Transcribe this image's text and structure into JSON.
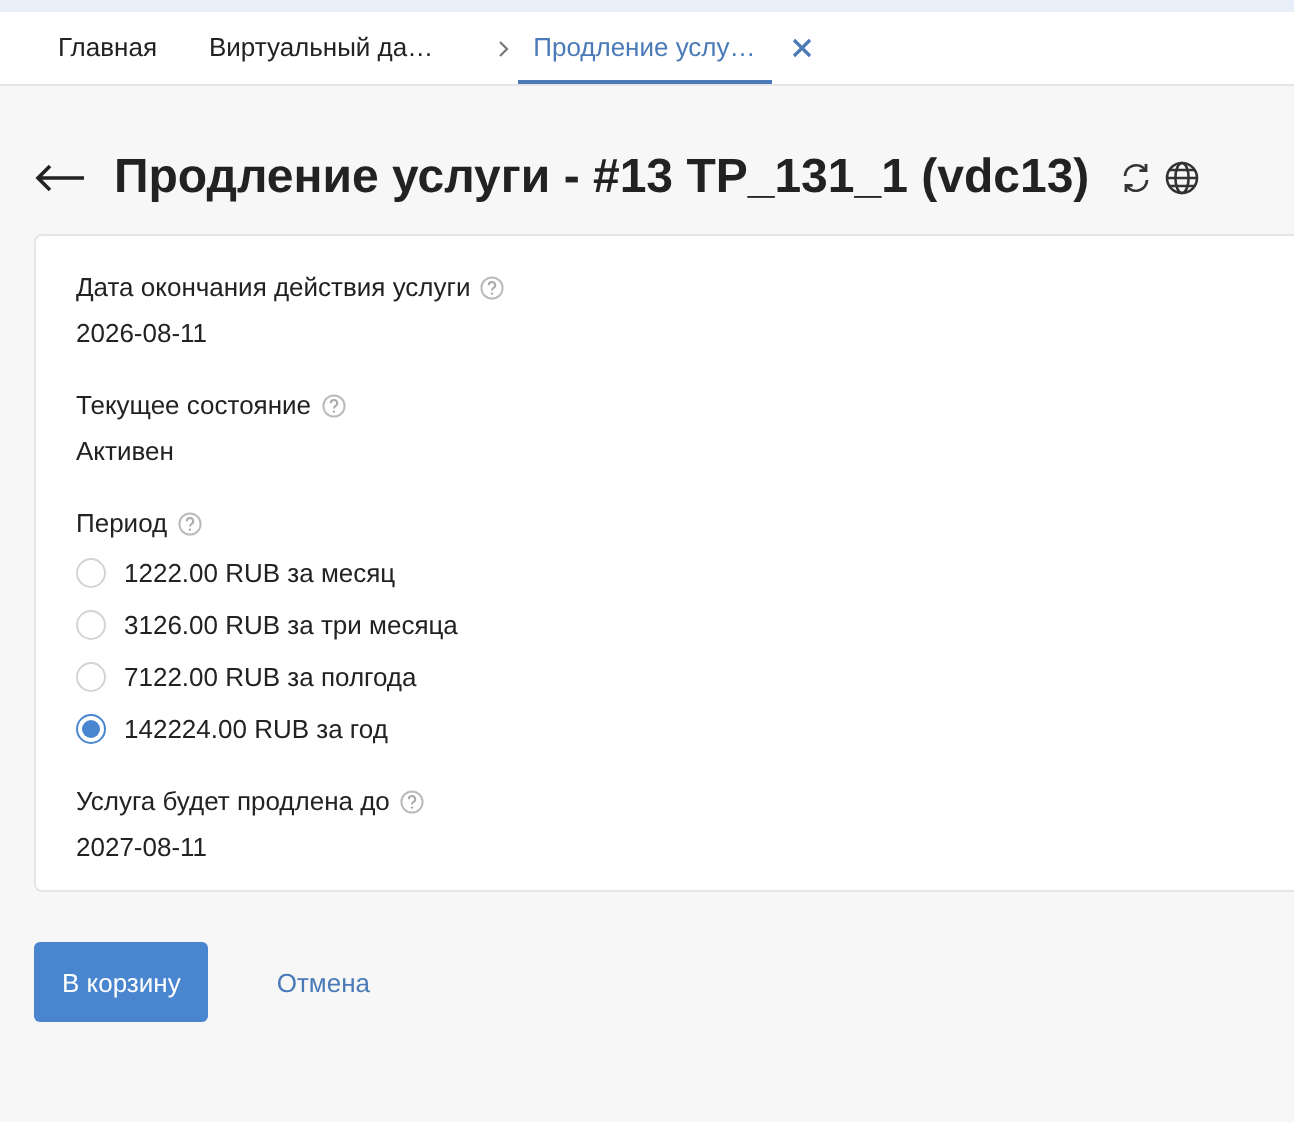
{
  "tabs": [
    {
      "label": "Главная",
      "selected": false,
      "closable": false
    },
    {
      "label": "Виртуальный да…",
      "selected": false,
      "closable": false
    },
    {
      "label": "Продление услу…",
      "selected": true,
      "closable": true
    }
  ],
  "title": "Продление услуги - #13 TP_131_1 (vdc13)",
  "fields": [
    {
      "kind": "text",
      "label": "Дата окончания действия услуги",
      "value": "2026-08-11"
    },
    {
      "kind": "text",
      "label": "Текущее состояние",
      "value": "Активен"
    },
    {
      "kind": "radio",
      "label": "Период",
      "options": [
        {
          "label": "1222.00 RUB за месяц",
          "selected": false
        },
        {
          "label": "3126.00 RUB за три месяца",
          "selected": false
        },
        {
          "label": "7122.00 RUB за полгода",
          "selected": false
        },
        {
          "label": "142224.00 RUB за год",
          "selected": true
        }
      ]
    },
    {
      "kind": "text",
      "label": "Услуга будет продлена до",
      "value": "2027-08-11"
    }
  ],
  "buttons": [
    {
      "kind": "primary",
      "label": "В корзину"
    },
    {
      "kind": "link",
      "label": "Отмена"
    }
  ]
}
